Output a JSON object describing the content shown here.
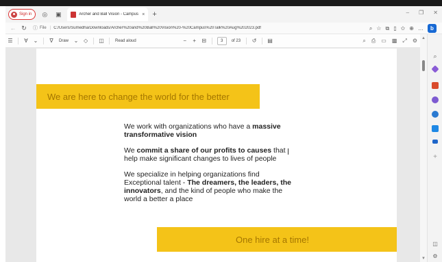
{
  "browser": {
    "signin_label": "Sign in",
    "tab_title": "Archer and Ball Vision - Campus",
    "tab_close": "×",
    "new_tab": "+",
    "window_controls": [
      "–",
      "❐",
      "✕"
    ],
    "url_prefix": "File",
    "url": "C:/Users/Sumedha/Downloads/Archer%20and%20Ball%20Vision%20-%20Campus%20Talk%20Aug%202023.pdf"
  },
  "pdf_toolbar": {
    "draw_label": "Draw",
    "read_aloud_label": "Read aloud",
    "zoom_out": "−",
    "zoom_in": "+",
    "current_page": "3",
    "page_total": "of 23"
  },
  "document": {
    "banner_top": "We are here to change the world for the better",
    "para1_pre": "We work with organizations who have a ",
    "para1_bold": "massive transformative vision",
    "para2_pre": "We ",
    "para2_bold": "commit a share of our profits to causes",
    "para2_post": " that help make significant changes to lives of people",
    "para3_pre": "We specialize in helping organizations find Exceptional talent - ",
    "para3_bold": "The dreamers, the leaders, the innovators",
    "para3_post": ", and the kind of people who make the world a better a place",
    "banner_bottom": "One hire at a time!"
  },
  "colors": {
    "banner_yellow": "#f4c318",
    "banner_text": "#a47600",
    "sidebar_icons": [
      "#1769d4",
      "#8a5cd6",
      "#d94a2b",
      "#7d5ad1",
      "#2a7ad1",
      "#1e88e5",
      "#1e66c9"
    ]
  },
  "icons": {
    "sidebar": [
      "bing-chat-icon",
      "search-icon",
      "tag-icon",
      "toolbox-icon",
      "people-icon",
      "office-icon",
      "outlook-icon",
      "send-icon",
      "add-icon"
    ]
  }
}
